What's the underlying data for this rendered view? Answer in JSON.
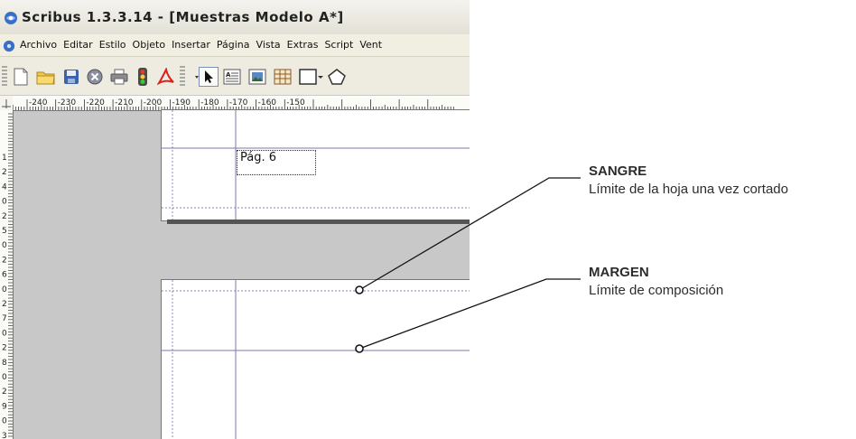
{
  "window": {
    "title": "Scribus 1.3.3.14 - [Muestras Modelo A*]"
  },
  "menubar": {
    "items": [
      "Archivo",
      "Editar",
      "Estilo",
      "Objeto",
      "Insertar",
      "Página",
      "Vista",
      "Extras",
      "Script",
      "Vent"
    ]
  },
  "toolbar": {
    "icons": [
      "new-document-icon",
      "open-folder-icon",
      "save-icon",
      "close-document-icon",
      "print-icon",
      "preflight-icon",
      "export-pdf-icon",
      "select-arrow-icon",
      "text-frame-icon",
      "image-frame-icon",
      "table-icon",
      "rectangle-shape-icon",
      "polygon-icon"
    ]
  },
  "ruler": {
    "h_labels": [
      "-240",
      "-230",
      "-220",
      "-210",
      "-200",
      "-190",
      "-180",
      "-170",
      "-160",
      "-150"
    ],
    "v_labels": [
      "1",
      "2",
      "4",
      "0",
      "2",
      "5",
      "0",
      "2",
      "6",
      "0",
      "2",
      "7",
      "0",
      "2",
      "8",
      "0",
      "2",
      "9",
      "0",
      "3"
    ]
  },
  "page": {
    "label": "Pág. 6"
  },
  "annotations": {
    "sangre": {
      "title": "SANGRE",
      "desc": "Límite de la hoja una vez cortado"
    },
    "margen": {
      "title": "MARGEN",
      "desc": "Límite de composición"
    }
  },
  "colors": {
    "guide_margin": "#7a7aaa",
    "guide_bleed": "#8a8ab8",
    "canvas_bg": "#c8c8c8",
    "annotation_text": "#2c2c2c"
  }
}
